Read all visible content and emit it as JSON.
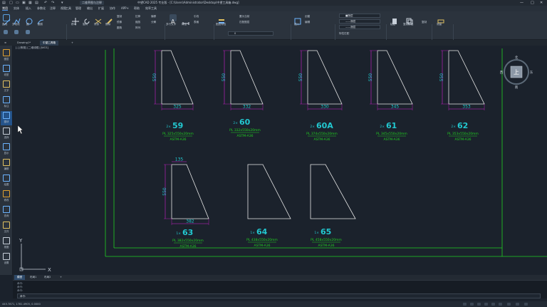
{
  "titlebar": {
    "app_button": "二维草图与注释",
    "title": "中望CAD 2025 专业版 - [C:\\Users\\Administrator\\Desktop\\中望工具箱.dwg]"
  },
  "menu": [
    "常用",
    "实体",
    "插入",
    "参数化",
    "注释",
    "视图",
    "工具",
    "管理",
    "输出",
    "扩展",
    "协作",
    "APP+",
    "帮助",
    "效率工具"
  ],
  "menu_active": 0,
  "ribbon": {
    "draw": {
      "items": [
        "直线",
        "多段线",
        "圆",
        "圆弧"
      ],
      "label": "绘图"
    },
    "modify": {
      "items": [
        "移动",
        "旋转",
        "修剪",
        "删除",
        "复制",
        "镜像",
        "圆角",
        "拉伸",
        "缩放",
        "阵列",
        "偏移",
        "分解"
      ],
      "label": "修改"
    },
    "annotate": {
      "items": [
        "多行文字",
        "标注",
        "引线",
        "表格"
      ],
      "label": "注释"
    },
    "layer": {
      "current": "0",
      "items": [
        "图层特性",
        "置为当前",
        "匹配图层"
      ],
      "label": "图层"
    },
    "block": {
      "items": [
        "插入",
        "创建",
        "编辑"
      ],
      "label": "块"
    },
    "properties": {
      "color": "■随层",
      "linetype": "——随层",
      "lineweight": "——随层",
      "items": [
        "特性匹配"
      ],
      "label": "特性"
    },
    "clipboard": {
      "items": [
        "粘贴",
        "复制剪贴",
        "复制"
      ],
      "label": "剪贴板"
    },
    "utility": {
      "items": [
        "测量",
        "剪贴板"
      ],
      "label": "工程视图"
    }
  },
  "doc_tabs": [
    "Drawing1*",
    "中望工具箱"
  ],
  "doc_tab_active": 1,
  "viewport_label": "[-] [俯视] [二维线框] [WCS]",
  "left_toolbar": [
    "图层",
    "线型",
    "文字",
    "标注",
    "图块",
    "选择",
    "显示",
    "编辑",
    "绘图",
    "修改",
    "查询",
    "文件",
    "视图",
    "设置"
  ],
  "left_toolbar_active": 4,
  "viewcube": {
    "face": "上",
    "north": "北",
    "south": "南",
    "east": "东",
    "west": "西"
  },
  "ucs": {
    "x": "X",
    "y": "Y"
  },
  "plates": [
    {
      "id": "59",
      "count": "2×",
      "height_dim": "550",
      "width_dim": "325",
      "spec": "PL 325x550x20mm",
      "material": "ASTM-A36"
    },
    {
      "id": "60",
      "count": "2×",
      "height_dim": "550",
      "width_dim": "332",
      "spec": "PL 332x550x20mm",
      "material": "ASTM-A36"
    },
    {
      "id": "60A",
      "count": "2×",
      "height_dim": "550",
      "width_dim": "330",
      "spec": "PL 374x550x20mm",
      "material": "ASTM-A36"
    },
    {
      "id": "61",
      "count": "2×",
      "height_dim": "550",
      "width_dim": "345",
      "spec": "PL 345x550x20mm",
      "material": "ASTM-A36"
    },
    {
      "id": "62",
      "count": "2×",
      "height_dim": "550",
      "width_dim": "353",
      "spec": "PL 353x550x20mm",
      "material": "ASTM-A36"
    },
    {
      "id": "63",
      "count": "1×",
      "height_dim": "550",
      "width_dim": "382",
      "top_dim": "135",
      "spec": "PL 382x550x20mm",
      "material": "ASTM-A36"
    },
    {
      "id": "64",
      "count": "1×",
      "spec": "PL 438x550x20mm",
      "material": "ASTM-A36"
    },
    {
      "id": "65",
      "count": "1×",
      "spec": "PL 458x550x20mm",
      "material": "ASTM-A36"
    }
  ],
  "cmd_tabs": [
    "模型",
    "布局1",
    "布局2",
    "+"
  ],
  "cmd_tab_active": 0,
  "command_history": [
    "命令:",
    "命令:",
    "命令:"
  ],
  "command_prompt": "命令:",
  "status": {
    "coordinates": "445.7871, 1781.4905, 0.0000"
  },
  "colors": {
    "canvas": "#1b222c",
    "accent": "#4a90e2",
    "dimension": "#d020d0",
    "label": "#22c8d0",
    "outline": "#e6e6e6",
    "border": "#21d021"
  }
}
